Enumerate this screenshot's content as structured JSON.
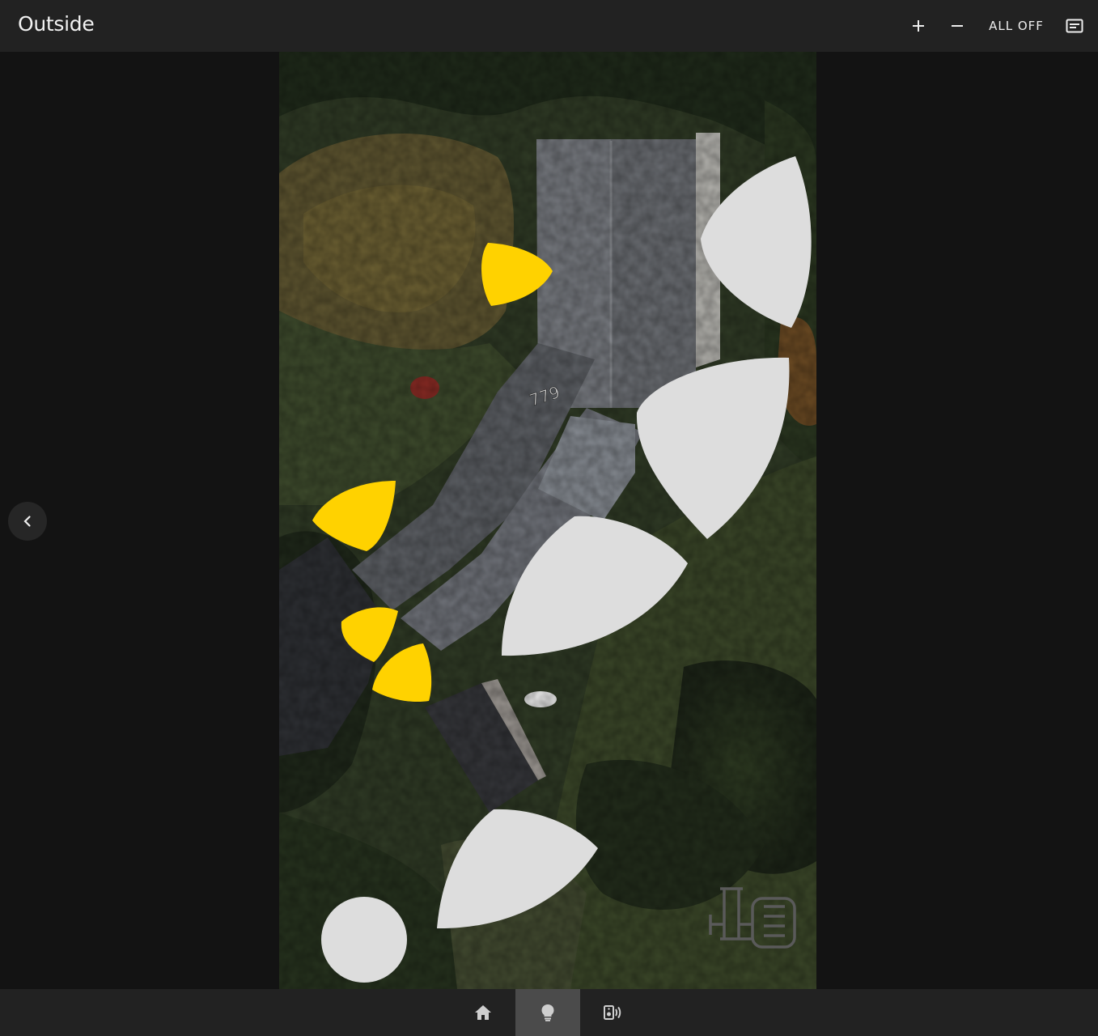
{
  "header": {
    "title": "Outside",
    "add_icon": "plus-icon",
    "remove_icon": "minus-icon",
    "all_off_label": "ALL OFF",
    "menu_icon": "subtitles-icon"
  },
  "map": {
    "house_number": "779",
    "lights": [
      {
        "name": "light-1",
        "state": "on",
        "color": "#ffd200"
      },
      {
        "name": "light-2",
        "state": "off",
        "color": "#dddddd"
      },
      {
        "name": "light-3",
        "state": "off",
        "color": "#dddddd"
      },
      {
        "name": "light-4",
        "state": "on",
        "color": "#ffd200"
      },
      {
        "name": "light-5",
        "state": "off",
        "color": "#dddddd"
      },
      {
        "name": "light-6",
        "state": "on",
        "color": "#ffd200"
      },
      {
        "name": "light-7",
        "state": "on",
        "color": "#ffd200"
      },
      {
        "name": "light-8",
        "state": "off",
        "color": "#dddddd"
      },
      {
        "name": "light-9",
        "state": "off",
        "color": "#dddddd"
      }
    ],
    "pump_icon": "pump-icon"
  },
  "navigation": {
    "back_icon": "chevron-left-icon",
    "tabs": [
      {
        "icon": "home-icon",
        "active": false
      },
      {
        "icon": "lightbulb-icon",
        "active": true
      },
      {
        "icon": "speaker-icon",
        "active": false
      }
    ]
  }
}
